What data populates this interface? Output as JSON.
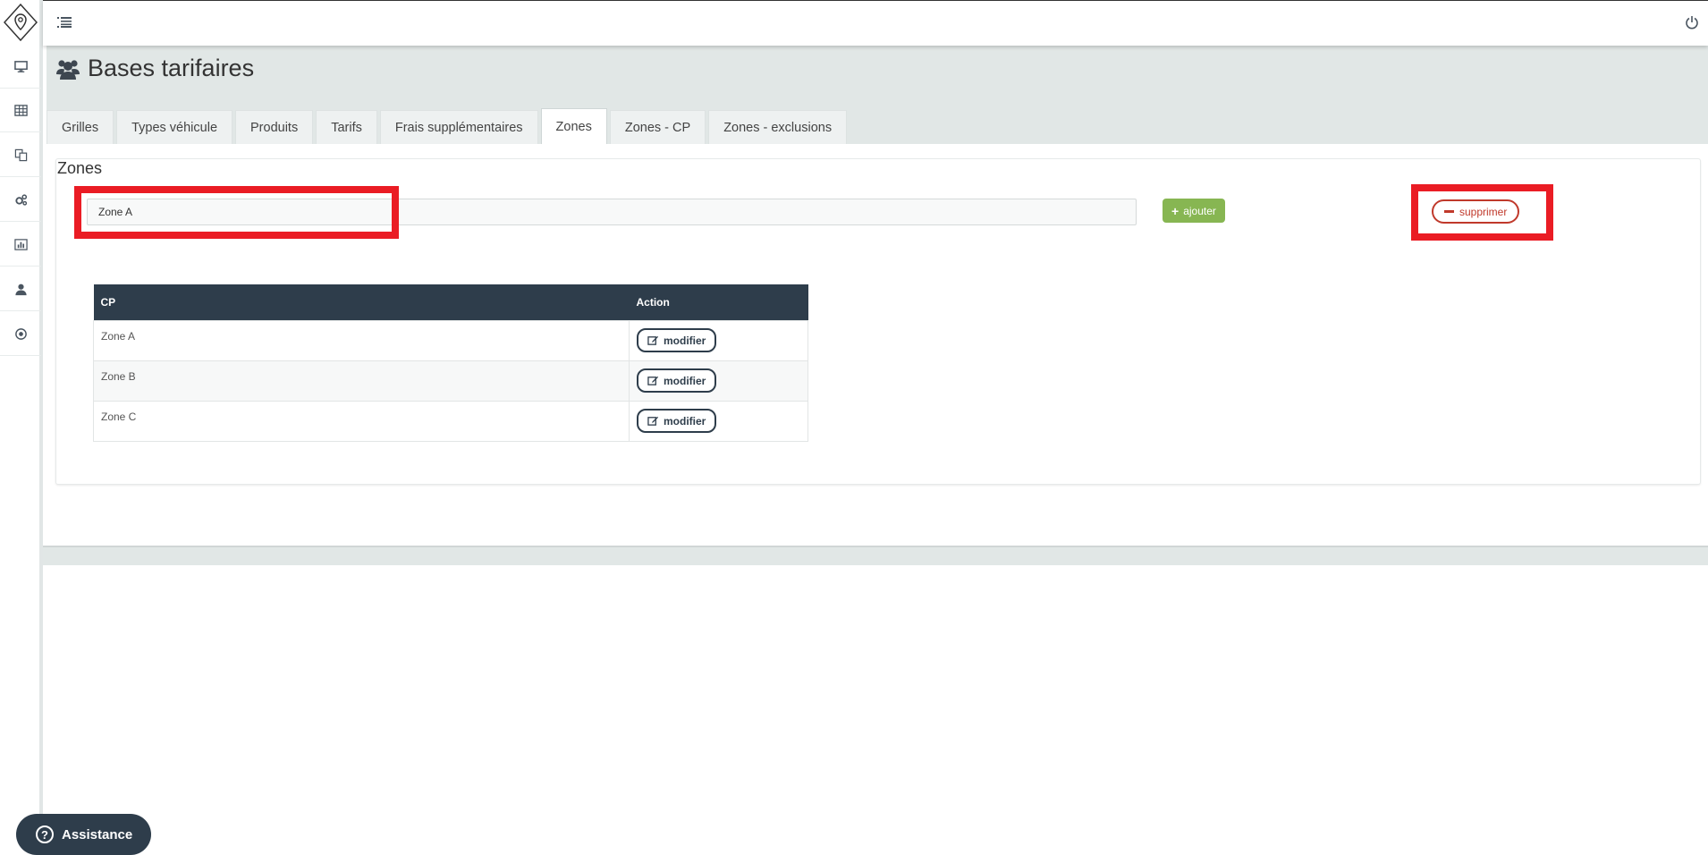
{
  "sidebar": {
    "items": [
      {
        "icon": "monitor-icon"
      },
      {
        "icon": "table-icon"
      },
      {
        "icon": "copy-icon"
      },
      {
        "icon": "cogs-icon"
      },
      {
        "icon": "bar-chart-icon"
      },
      {
        "icon": "user-icon"
      },
      {
        "icon": "target-icon"
      }
    ]
  },
  "header": {
    "title": "Bases tarifaires"
  },
  "tabs": [
    {
      "label": "Grilles",
      "active": false
    },
    {
      "label": "Types véhicule",
      "active": false
    },
    {
      "label": "Produits",
      "active": false
    },
    {
      "label": "Tarifs",
      "active": false
    },
    {
      "label": "Frais supplémentaires",
      "active": false
    },
    {
      "label": "Zones",
      "active": true
    },
    {
      "label": "Zones - CP",
      "active": false
    },
    {
      "label": "Zones - exclusions",
      "active": false
    }
  ],
  "panel": {
    "title": "Zones",
    "zone_input_value": "Zone A",
    "add_label": "ajouter",
    "delete_label": "supprimer"
  },
  "table": {
    "headers": [
      "CP",
      "Action"
    ],
    "rows": [
      {
        "name": "Zone A",
        "action": "modifier"
      },
      {
        "name": "Zone B",
        "action": "modifier"
      },
      {
        "name": "Zone C",
        "action": "modifier"
      }
    ]
  },
  "assistance": {
    "label": "Assistance"
  },
  "colors": {
    "dark": "#2e3d4b",
    "add_green": "#87b652",
    "delete_red": "#c0392b",
    "highlight_red": "#ea1c24",
    "header_bg": "#e1e7e6"
  }
}
